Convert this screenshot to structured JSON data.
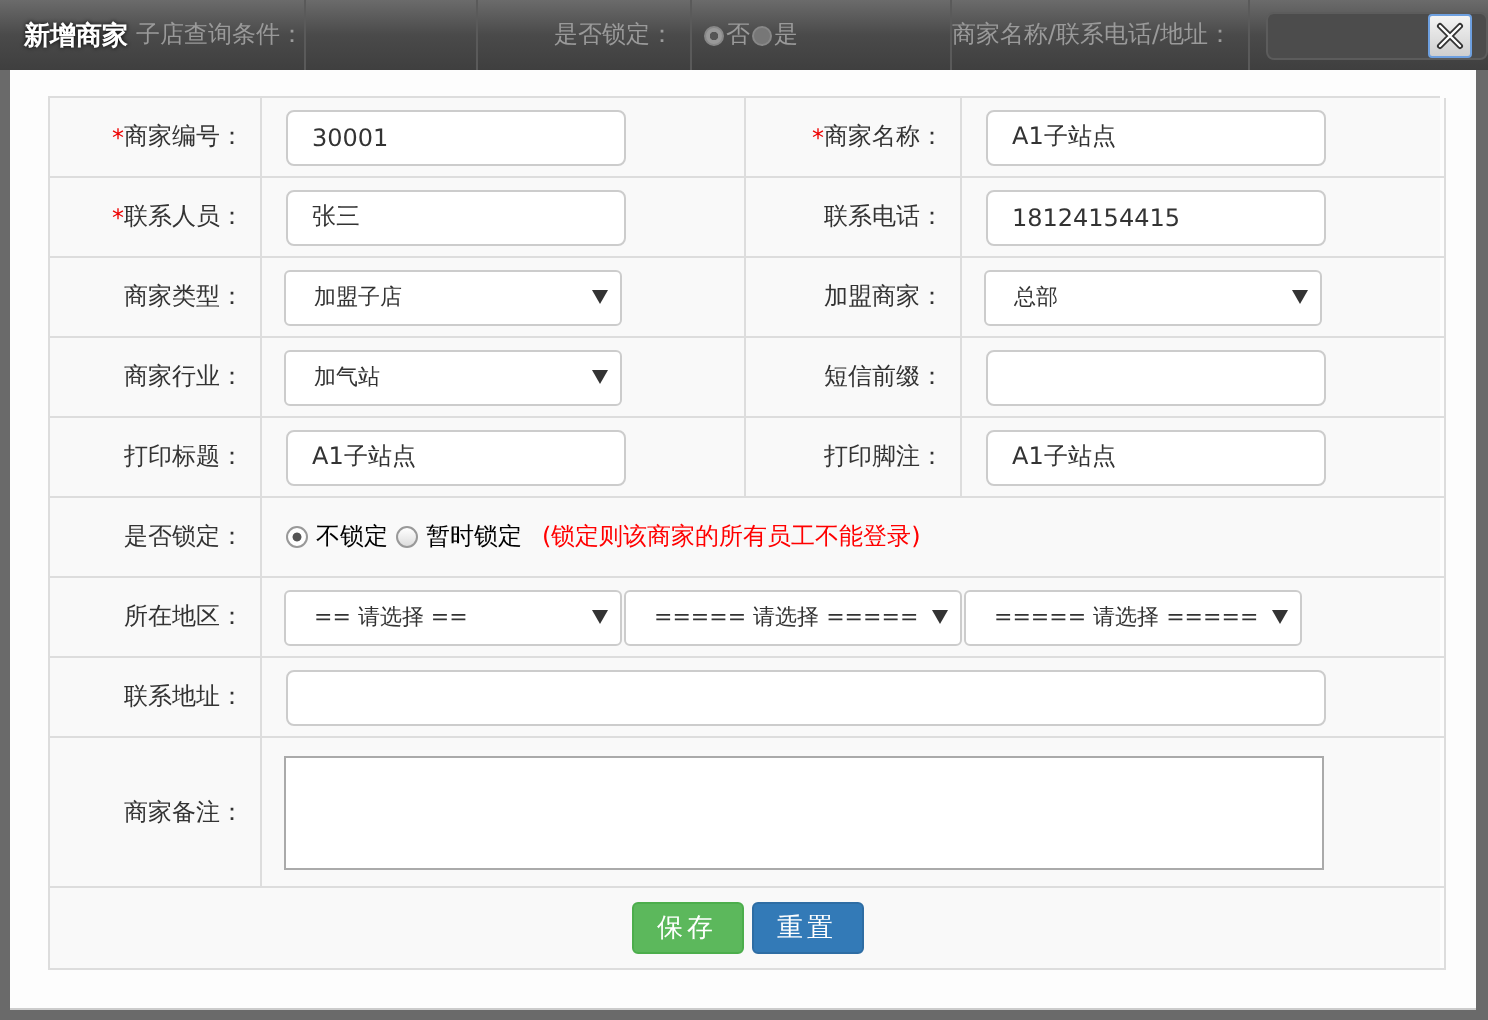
{
  "background_toolbar": {
    "filter_label": "子店查询条件：",
    "lock_label": "是否锁定：",
    "lock_options": [
      {
        "label": "否",
        "selected": true
      },
      {
        "label": "是",
        "selected": false
      }
    ],
    "search_label": "商家名称/联系电话/地址："
  },
  "dialog": {
    "title": "新增商家"
  },
  "form": {
    "pair_rows": [
      [
        {
          "mark": "*",
          "label": "商家编号：",
          "kind": "text",
          "value": "30001"
        },
        {
          "mark": "*",
          "label": "商家名称：",
          "kind": "text",
          "value": "A1子站点"
        }
      ],
      [
        {
          "mark": "*",
          "label": "联系人员：",
          "kind": "text",
          "value": "张三"
        },
        {
          "label": "联系电话：",
          "kind": "text",
          "value": "18124154415"
        }
      ],
      [
        {
          "label": "商家类型：",
          "kind": "select",
          "value": "加盟子店"
        },
        {
          "label": "加盟商家：",
          "kind": "select",
          "value": "总部"
        }
      ],
      [
        {
          "label": "商家行业：",
          "kind": "select",
          "value": "加气站"
        },
        {
          "label": "短信前缀：",
          "kind": "text"
        }
      ],
      [
        {
          "label": "打印标题：",
          "kind": "text",
          "value": "A1子站点"
        },
        {
          "label": "打印脚注：",
          "kind": "text",
          "value": "A1子站点"
        }
      ]
    ],
    "lock": {
      "label": "是否锁定：",
      "options": [
        {
          "label": "不锁定",
          "selected": true
        },
        {
          "label": "暂时锁定",
          "selected": false
        }
      ],
      "note": "(锁定则该商家的所有员工不能登录)"
    },
    "region": {
      "label": "所在地区：",
      "selects": [
        "== 请选择 ==",
        "===== 请选择 =====",
        "===== 请选择 ====="
      ]
    },
    "address": {
      "label": "联系地址："
    },
    "remark": {
      "label": "商家备注："
    },
    "buttons": [
      {
        "label": "保存",
        "kind": "success"
      },
      {
        "label": "重置",
        "kind": "primary"
      }
    ]
  }
}
